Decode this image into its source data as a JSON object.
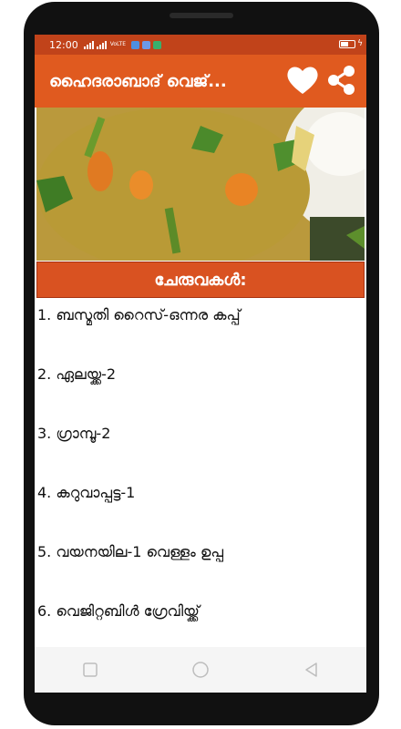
{
  "status_bar": {
    "time": "12:00",
    "network_label": "VoLTE",
    "colors": {
      "background": "#c1431a",
      "text": "#ffffff"
    }
  },
  "app_bar": {
    "title": "ഹൈദരാബാദ് വെജ്...",
    "favorite_icon": "heart-icon",
    "share_icon": "share-icon",
    "color": "#e05a1f"
  },
  "hero_image": {
    "description_icon": "vegetable-rice-photo"
  },
  "section_header": {
    "label": "ചേരുവകൾ:",
    "color": "#d95221"
  },
  "ingredients": [
    {
      "label": "1. ബസ്മതി റൈസ്-ഒന്നര കപ്പ്"
    },
    {
      "label": "2. ഏലയ്ക്ക-2"
    },
    {
      "label": "3. ഗ്രാമ്പൂ-2"
    },
    {
      "label": "4. കറുവാപ്പട്ട-1"
    },
    {
      "label": "5. വയനയില-1 വെള്ളം ഉപ്പ"
    },
    {
      "label": "6. വെജിറ്റബിൾ ഗ്രേവിയ്ക്ക്"
    }
  ],
  "nav_bar": {
    "buttons": [
      "recent-apps-icon",
      "home-icon",
      "back-icon"
    ]
  }
}
